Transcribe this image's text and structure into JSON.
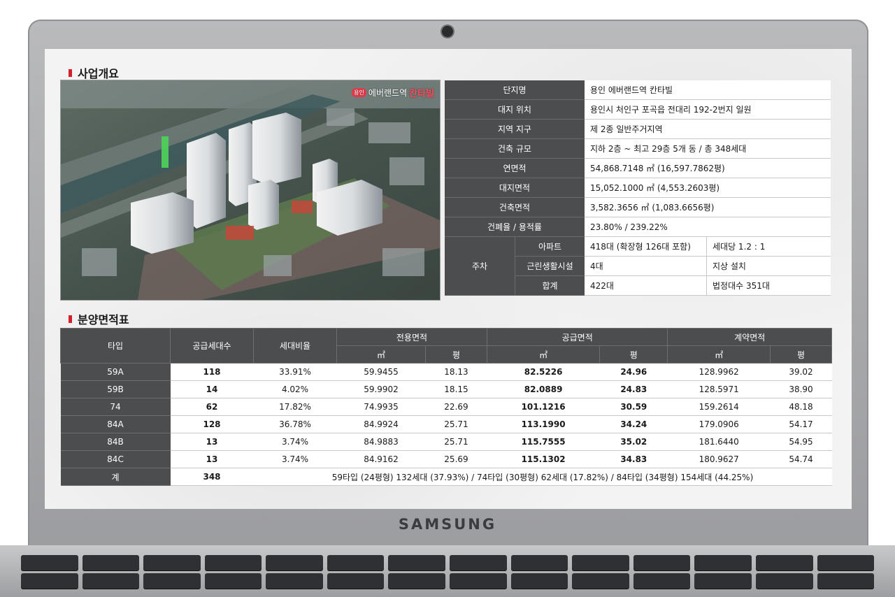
{
  "device": {
    "brand": "SAMSUNG"
  },
  "sections": {
    "overview_title": "사업개요",
    "area_title": "분양면적표"
  },
  "render": {
    "badge": "용인",
    "logo_text": "에버랜드역",
    "logo_strong": "칸타빌"
  },
  "overview": {
    "rows": [
      {
        "label": "단지명",
        "value": "용인 에버랜드역 칸타빌"
      },
      {
        "label": "대지 위치",
        "value": "용인시 처인구 포곡읍 전대리 192-2번지 일원"
      },
      {
        "label": "지역 지구",
        "value": "제 2종 일반주거지역"
      },
      {
        "label": "건축 규모",
        "value": "지하 2층 ~ 최고 29층 5개 동 / 총 348세대"
      },
      {
        "label": "연면적",
        "value": "54,868.7148 ㎡ (16,597.7862평)"
      },
      {
        "label": "대지면적",
        "value": "15,052.1000 ㎡ (4,553.2603평)"
      },
      {
        "label": "건축면적",
        "value": "3,582.3656 ㎡  (1,083.6656평)"
      },
      {
        "label": "건폐율 / 용적률",
        "value": "23.80% / 239.22%"
      }
    ],
    "parking": {
      "label": "주차",
      "rows": [
        {
          "label": "아파트",
          "value": "418대 (확장형 126대 포함)",
          "note": "세대당 1.2 : 1"
        },
        {
          "label": "근린생활시설",
          "value": "4대",
          "note": "지상 설치"
        },
        {
          "label": "합계",
          "value": "422대",
          "note": "법정대수 351대"
        }
      ]
    }
  },
  "area_table": {
    "headers": {
      "type": "타입",
      "units": "공급세대수",
      "ratio": "세대비율",
      "exclusive": "전용면적",
      "supply": "공급면적",
      "contract": "계약면적",
      "sqm": "㎡",
      "pyeong": "평"
    },
    "rows": [
      {
        "type": "59A",
        "units": "118",
        "ratio": "33.91%",
        "ex_m": "59.9455",
        "ex_p": "18.13",
        "su_m": "82.5226",
        "su_p": "24.96",
        "co_m": "128.9962",
        "co_p": "39.02"
      },
      {
        "type": "59B",
        "units": "14",
        "ratio": "4.02%",
        "ex_m": "59.9902",
        "ex_p": "18.15",
        "su_m": "82.0889",
        "su_p": "24.83",
        "co_m": "128.5971",
        "co_p": "38.90"
      },
      {
        "type": "74",
        "units": "62",
        "ratio": "17.82%",
        "ex_m": "74.9935",
        "ex_p": "22.69",
        "su_m": "101.1216",
        "su_p": "30.59",
        "co_m": "159.2614",
        "co_p": "48.18"
      },
      {
        "type": "84A",
        "units": "128",
        "ratio": "36.78%",
        "ex_m": "84.9924",
        "ex_p": "25.71",
        "su_m": "113.1990",
        "su_p": "34.24",
        "co_m": "179.0906",
        "co_p": "54.17"
      },
      {
        "type": "84B",
        "units": "13",
        "ratio": "3.74%",
        "ex_m": "84.9883",
        "ex_p": "25.71",
        "su_m": "115.7555",
        "su_p": "35.02",
        "co_m": "181.6440",
        "co_p": "54.95"
      },
      {
        "type": "84C",
        "units": "13",
        "ratio": "3.74%",
        "ex_m": "84.9162",
        "ex_p": "25.69",
        "su_m": "115.1302",
        "su_p": "34.83",
        "co_m": "180.9627",
        "co_p": "54.74"
      }
    ],
    "total": {
      "label": "계",
      "units": "348",
      "summary": "59타입 (24평형) 132세대 (37.93%) / 74타입 (30평형) 62세대 (17.82%) / 84타입 (34평형) 154세대 (44.25%)"
    }
  }
}
